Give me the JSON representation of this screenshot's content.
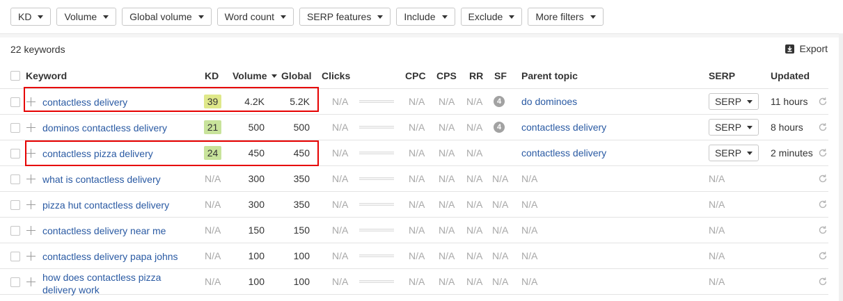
{
  "filters": [
    {
      "label": "KD"
    },
    {
      "label": "Volume"
    },
    {
      "label": "Global volume"
    },
    {
      "label": "Word count"
    },
    {
      "label": "SERP features"
    },
    {
      "label": "Include"
    },
    {
      "label": "Exclude"
    },
    {
      "label": "More filters"
    }
  ],
  "summary": {
    "keyword_count": "22 keywords",
    "export_label": "Export"
  },
  "columns": {
    "keyword": "Keyword",
    "kd": "KD",
    "volume": "Volume",
    "global": "Global",
    "clicks": "Clicks",
    "cpc": "CPC",
    "cps": "CPS",
    "rr": "RR",
    "sf": "SF",
    "parent_topic": "Parent topic",
    "serp": "SERP",
    "updated": "Updated"
  },
  "colors": {
    "kd_easy": "#c8e39b",
    "kd_medium": "#dfe88a",
    "highlight": "#e60000",
    "link": "#2a5aa3"
  },
  "serp_button_label": "SERP",
  "rows": [
    {
      "keyword": [
        "contactless delivery"
      ],
      "kd": "39",
      "kd_color": "#dfe88a",
      "volume": "4.2K",
      "global": "5.2K",
      "clicks": "N/A",
      "cpc": "N/A",
      "cps": "N/A",
      "rr": "N/A",
      "sf": "4",
      "parent": "do dominoes",
      "parent_link": true,
      "serp": "button",
      "updated": "11 hours"
    },
    {
      "keyword": [
        "dominos contactless delivery"
      ],
      "kd": "21",
      "kd_color": "#c8e39b",
      "volume": "500",
      "global": "500",
      "clicks": "N/A",
      "cpc": "N/A",
      "cps": "N/A",
      "rr": "N/A",
      "sf": "4",
      "parent": "contactless delivery",
      "parent_link": true,
      "serp": "button",
      "updated": "8 hours"
    },
    {
      "keyword": [
        "contactless pizza delivery"
      ],
      "kd": "24",
      "kd_color": "#c8e39b",
      "volume": "450",
      "global": "450",
      "clicks": "N/A",
      "cpc": "N/A",
      "cps": "N/A",
      "rr": "N/A",
      "sf": "",
      "parent": "contactless delivery",
      "parent_link": true,
      "serp": "button",
      "updated": "2 minutes"
    },
    {
      "keyword": [
        "what is contactless delivery"
      ],
      "kd": "N/A",
      "kd_color": "",
      "volume": "300",
      "global": "350",
      "clicks": "N/A",
      "cpc": "N/A",
      "cps": "N/A",
      "rr": "N/A",
      "sf": "N/A",
      "parent": "N/A",
      "parent_link": false,
      "serp": "N/A",
      "updated": ""
    },
    {
      "keyword": [
        "pizza hut contactless delivery"
      ],
      "kd": "N/A",
      "kd_color": "",
      "volume": "300",
      "global": "350",
      "clicks": "N/A",
      "cpc": "N/A",
      "cps": "N/A",
      "rr": "N/A",
      "sf": "N/A",
      "parent": "N/A",
      "parent_link": false,
      "serp": "N/A",
      "updated": ""
    },
    {
      "keyword": [
        "contactless delivery near me"
      ],
      "kd": "N/A",
      "kd_color": "",
      "volume": "150",
      "global": "150",
      "clicks": "N/A",
      "cpc": "N/A",
      "cps": "N/A",
      "rr": "N/A",
      "sf": "N/A",
      "parent": "N/A",
      "parent_link": false,
      "serp": "N/A",
      "updated": ""
    },
    {
      "keyword": [
        "contactless delivery papa johns"
      ],
      "kd": "N/A",
      "kd_color": "",
      "volume": "100",
      "global": "100",
      "clicks": "N/A",
      "cpc": "N/A",
      "cps": "N/A",
      "rr": "N/A",
      "sf": "N/A",
      "parent": "N/A",
      "parent_link": false,
      "serp": "N/A",
      "updated": ""
    },
    {
      "keyword": [
        "how does contactless pizza",
        "delivery work"
      ],
      "kd": "N/A",
      "kd_color": "",
      "volume": "100",
      "global": "100",
      "clicks": "N/A",
      "cpc": "N/A",
      "cps": "N/A",
      "rr": "N/A",
      "sf": "N/A",
      "parent": "N/A",
      "parent_link": false,
      "serp": "N/A",
      "updated": ""
    }
  ]
}
